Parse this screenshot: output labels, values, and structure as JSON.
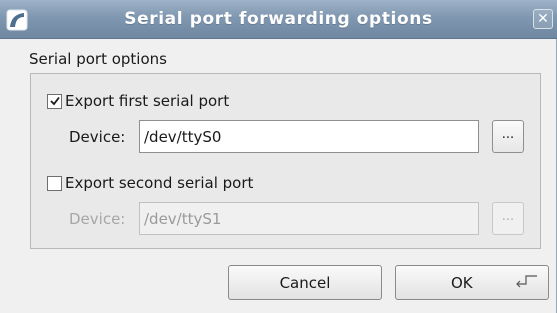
{
  "window": {
    "title": "Serial port forwarding options",
    "close_glyph": "✕",
    "icons": {
      "app": "app-icon",
      "close": "close-icon"
    }
  },
  "group": {
    "title": "Serial port options"
  },
  "port1": {
    "checkbox_label": "Export first serial port",
    "checked": true,
    "device_label": "Device:",
    "device_value": "/dev/ttyS0",
    "browse_label": "...",
    "enabled": true
  },
  "port2": {
    "checkbox_label": "Export second serial port",
    "checked": false,
    "device_label": "Device:",
    "device_value": "/dev/ttyS1",
    "browse_label": "...",
    "enabled": false
  },
  "buttons": {
    "cancel": "Cancel",
    "ok": "OK",
    "ok_icon": "enter-key-icon"
  },
  "colors": {
    "titlebar": "#7f97b0",
    "window_bg": "#f0f0f0",
    "group_bg": "#e9e9e9",
    "disabled_text": "#a6a6a6"
  }
}
